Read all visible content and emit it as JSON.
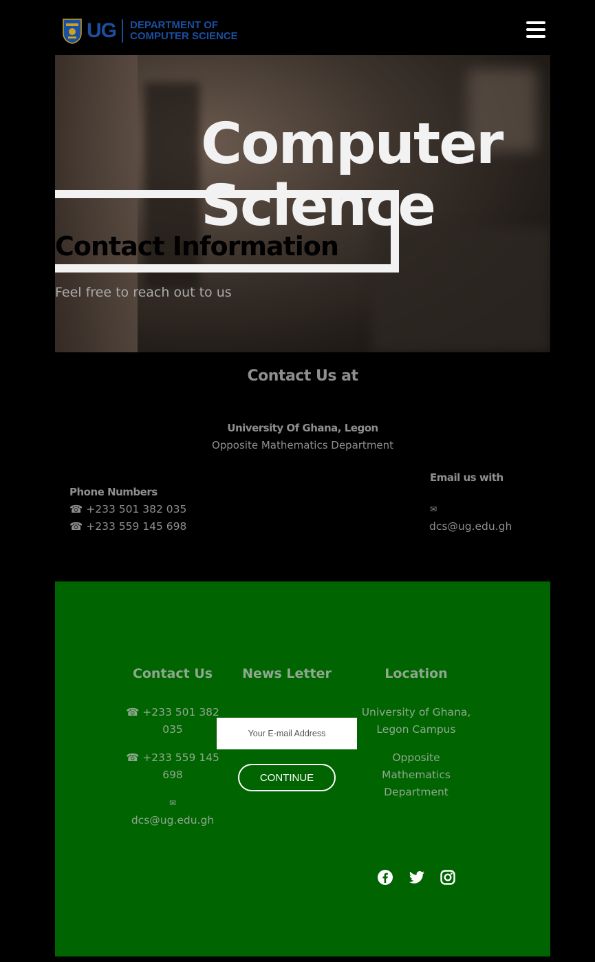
{
  "header": {
    "logo_text": "UG",
    "dept_line1": "DEPARTMENT OF",
    "dept_line2": "COMPUTER SCIENCE",
    "menu_icon": "hamburger-menu-icon"
  },
  "hero": {
    "background_line1": "Computer",
    "background_line2": "Science",
    "title": "Contact Information",
    "subtitle": "Feel free to reach out to us"
  },
  "contact": {
    "heading": "Contact Us at",
    "address_line1": "University Of Ghana, Legon",
    "address_line2": "Opposite Mathematics Department",
    "phone_label": "Phone Numbers",
    "phones": [
      "☎ +233 501 382 035",
      "☎ +233 559 145 698"
    ],
    "email_label": "Email us with",
    "email_icon": "✉",
    "email": "dcs@ug.edu.gh"
  },
  "footer": {
    "col_contact": {
      "heading": "Contact Us",
      "phone1_line1": "☎ +233 501 382",
      "phone1_line2": "035",
      "phone2_line1": "☎ +233 559 145",
      "phone2_line2": "698",
      "email_icon": "✉",
      "email": "dcs@ug.edu.gh"
    },
    "col_newsletter": {
      "heading": "News Letter",
      "placeholder": "Your E-mail Address",
      "button": "CONTINUE"
    },
    "col_location": {
      "heading": "Location",
      "line1": "University of Ghana,",
      "line2": "Legon Campus",
      "line3": "Opposite",
      "line4": "Mathematics",
      "line5": "Department"
    },
    "social": [
      "facebook-icon",
      "twitter-icon",
      "instagram-icon"
    ]
  },
  "colors": {
    "background": "#000000",
    "footer": "#006400",
    "brand_blue": "#1b4fa0",
    "muted_text": "#8e8e8e"
  }
}
